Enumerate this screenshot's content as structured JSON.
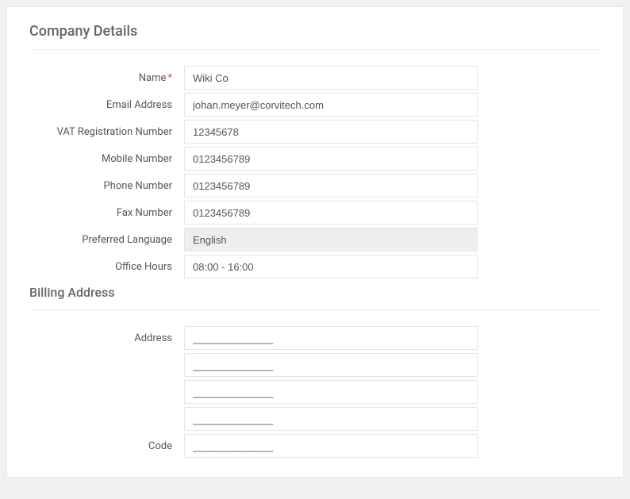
{
  "company": {
    "section_title": "Company Details",
    "fields": {
      "name": {
        "label": "Name",
        "value": "Wiki Co",
        "required": true
      },
      "email": {
        "label": "Email Address",
        "value": "johan.meyer@corvitech.com"
      },
      "vat": {
        "label": "VAT Registration Number",
        "value": "12345678"
      },
      "mobile": {
        "label": "Mobile Number",
        "value": "0123456789"
      },
      "phone": {
        "label": "Phone Number",
        "value": "0123456789"
      },
      "fax": {
        "label": "Fax Number",
        "value": "0123456789"
      },
      "language": {
        "label": "Preferred Language",
        "value": "English"
      },
      "hours": {
        "label": "Office Hours",
        "value": "08:00 - 16:00"
      }
    }
  },
  "billing": {
    "section_title": "Billing Address",
    "fields": {
      "address": {
        "label": "Address"
      },
      "address_line1": {
        "value": "______________"
      },
      "address_line2": {
        "value": "______________"
      },
      "address_line3": {
        "value": "______________"
      },
      "address_line4": {
        "value": "______________"
      },
      "code": {
        "label": "Code",
        "value": "______________"
      }
    }
  }
}
